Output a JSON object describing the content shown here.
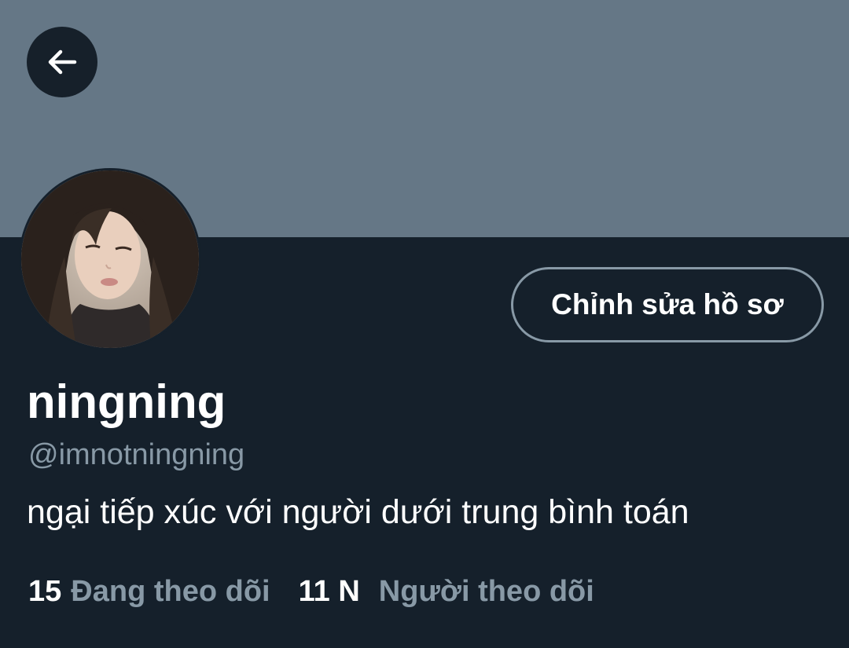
{
  "header": {
    "back_icon": "arrow-left-icon",
    "banner_color": "#657786"
  },
  "profile": {
    "display_name": "ningning",
    "handle": "@imnotningning",
    "bio": "ngại tiếp xúc với người dưới trung bình toán",
    "avatar": "profile-photo"
  },
  "actions": {
    "edit_profile_label": "Chỉnh sửa hồ sơ"
  },
  "stats": {
    "following_count": "15",
    "following_label": "Đang theo dõi",
    "followers_count": "11 N",
    "followers_label": "Người theo dõi"
  },
  "colors": {
    "background": "#15202b",
    "secondary_text": "#8899a6",
    "primary_text": "#ffffff"
  }
}
